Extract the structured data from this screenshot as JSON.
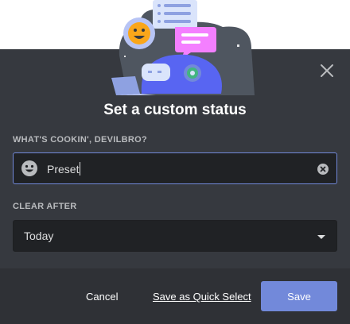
{
  "dialog": {
    "title": "Set a custom status",
    "status_label": "WHAT'S COOKIN', DEVILBRO?",
    "status_value": "Preset",
    "clear_after_label": "CLEAR AFTER",
    "clear_after_value": "Today"
  },
  "footer": {
    "cancel_label": "Cancel",
    "quick_select_label": "Save as Quick Select",
    "save_label": "Save"
  },
  "icons": {
    "close": "close-icon",
    "emoji": "smiley-emoji-icon",
    "clear": "clear-circle-x-icon",
    "dropdown": "chevron-down-icon"
  },
  "colors": {
    "modal_bg": "#36393f",
    "footer_bg": "#2f3136",
    "input_bg": "#202225",
    "accent": "#7289da",
    "text": "#dcddde",
    "label": "#b9bbbe"
  }
}
